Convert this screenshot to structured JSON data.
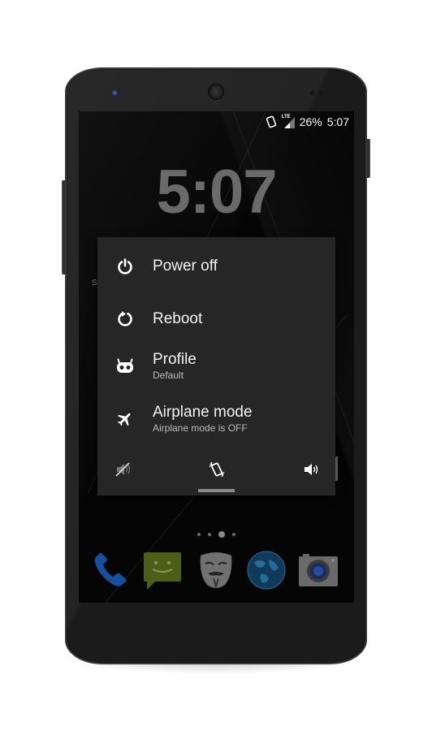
{
  "status_bar": {
    "icons": [
      "vibrate-icon",
      "lte-signal-icon"
    ],
    "network_label": "LTE",
    "battery": "26%",
    "time": "5:07"
  },
  "lockscreen": {
    "clock": "5:07",
    "partial_text": "S"
  },
  "power_menu": {
    "items": [
      {
        "icon": "power-icon",
        "label": "Power off",
        "sublabel": ""
      },
      {
        "icon": "reboot-icon",
        "label": "Reboot",
        "sublabel": ""
      },
      {
        "icon": "profile-icon",
        "label": "Profile",
        "sublabel": "Default"
      },
      {
        "icon": "airplane-icon",
        "label": "Airplane mode",
        "sublabel": "Airplane mode is OFF"
      }
    ],
    "sound_modes": [
      {
        "icon": "mute-icon",
        "name": "Silent",
        "selected": false
      },
      {
        "icon": "vibrate-icon",
        "name": "Vibrate",
        "selected": true
      },
      {
        "icon": "volume-icon",
        "name": "Sound",
        "selected": false
      }
    ]
  },
  "home": {
    "pages": 4,
    "current_page": 3,
    "dock": [
      {
        "icon": "phone-icon",
        "name": "Phone"
      },
      {
        "icon": "messaging-icon",
        "name": "Messaging"
      },
      {
        "icon": "mask-icon",
        "name": "Mask app"
      },
      {
        "icon": "globe-icon",
        "name": "Browser"
      },
      {
        "icon": "camera-icon",
        "name": "Camera"
      }
    ]
  },
  "colors": {
    "dialog_bg": "#262626",
    "text_primary": "#f2f2f2",
    "text_secondary": "#bdbdbd",
    "clock": "#6a6a6a",
    "selection_indicator": "#8a8a8a"
  }
}
